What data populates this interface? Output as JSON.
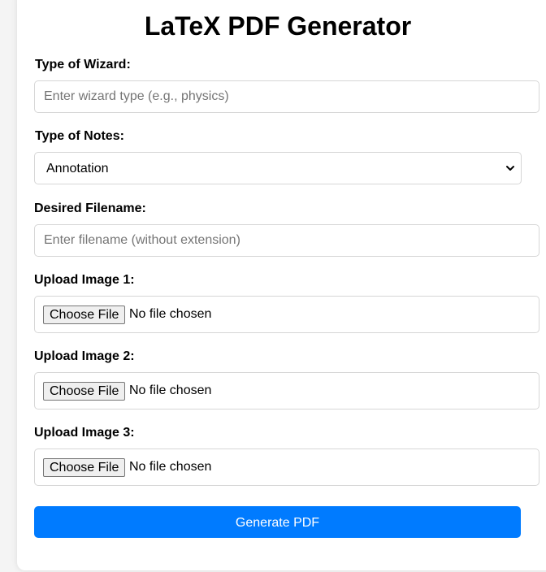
{
  "title": "LaTeX PDF Generator",
  "fields": {
    "wizard": {
      "label": "Type of Wizard:",
      "placeholder": "Enter wizard type (e.g., physics)",
      "value": ""
    },
    "notes": {
      "label": "Type of Notes:",
      "selected": "Annotation",
      "icon": "chevron-down-icon"
    },
    "filename": {
      "label": "Desired Filename:",
      "placeholder": "Enter filename (without extension)",
      "value": ""
    },
    "image1": {
      "label": "Upload Image 1:",
      "button": "Choose File",
      "status": "No file chosen"
    },
    "image2": {
      "label": "Upload Image 2:",
      "button": "Choose File",
      "status": "No file chosen"
    },
    "image3": {
      "label": "Upload Image 3:",
      "button": "Choose File",
      "status": "No file chosen"
    }
  },
  "submit": {
    "label": "Generate PDF"
  },
  "colors": {
    "accent": "#007bff",
    "background": "#f4f4f4",
    "card": "#ffffff"
  }
}
